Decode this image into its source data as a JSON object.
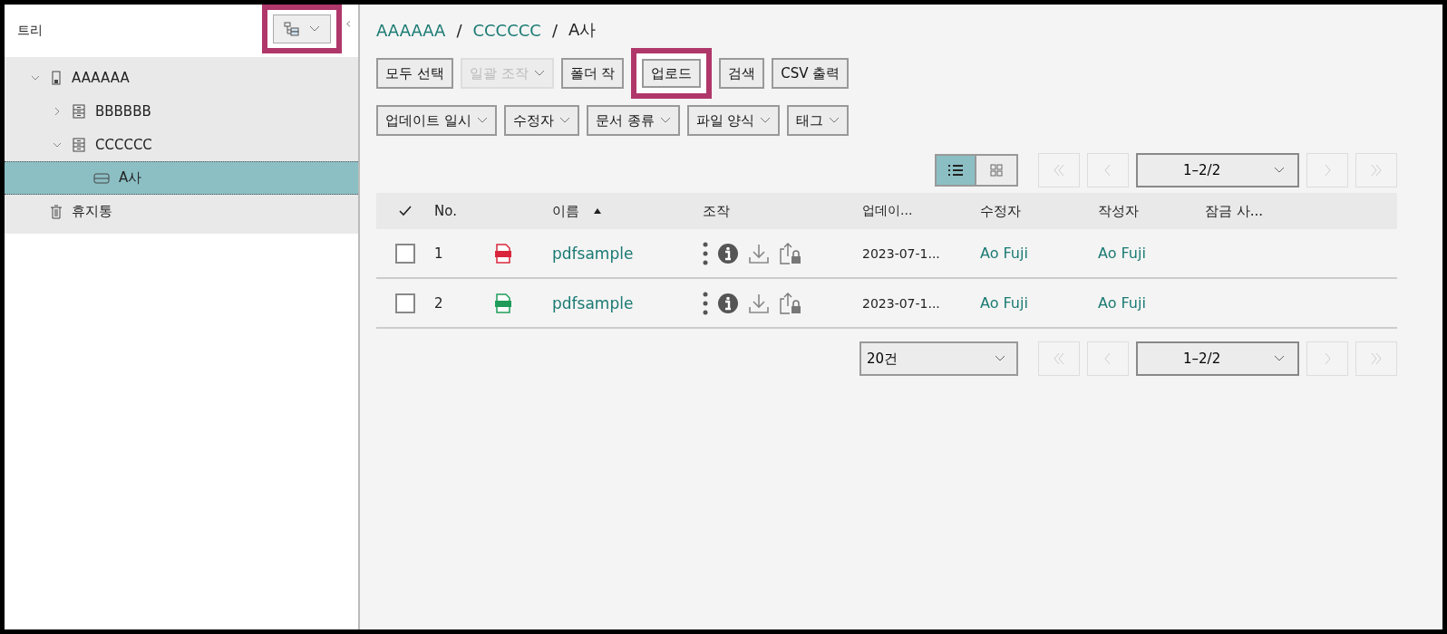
{
  "tree_panel": {
    "title": "트리",
    "collapse_glyph": "‹"
  },
  "tree": [
    {
      "label": "AAAAAA",
      "kind": "cabinet",
      "expanded": true,
      "selected": false,
      "children": [
        {
          "label": "BBBBBB",
          "kind": "drawer",
          "expanded": false,
          "selected": false
        },
        {
          "label": "CCCCCC",
          "kind": "drawer",
          "expanded": true,
          "selected": false,
          "children": [
            {
              "label": "A사",
              "kind": "folder",
              "selected": true
            }
          ]
        }
      ]
    },
    {
      "label": "휴지통",
      "kind": "trash",
      "selected": false
    }
  ],
  "breadcrumb": [
    {
      "label": "AAAAAA",
      "kind": "link"
    },
    {
      "label": "/",
      "kind": "separator"
    },
    {
      "label": "CCCCCC",
      "kind": "link"
    },
    {
      "label": "/",
      "kind": "separator"
    },
    {
      "label": "A사",
      "kind": "current"
    }
  ],
  "toolbar": [
    {
      "label": "모두 선택",
      "disabled": false,
      "dropdown": false,
      "highlighted": false
    },
    {
      "label": "일괄 조작",
      "disabled": true,
      "dropdown": true,
      "highlighted": false
    },
    {
      "label": "폴더 작",
      "disabled": false,
      "dropdown": false,
      "highlighted": false
    },
    {
      "label": "업로드",
      "disabled": false,
      "dropdown": false,
      "highlighted": true
    },
    {
      "label": "검색",
      "disabled": false,
      "dropdown": false,
      "highlighted": false
    },
    {
      "label": "CSV 출력",
      "disabled": false,
      "dropdown": false,
      "highlighted": false
    }
  ],
  "filters": [
    {
      "label": "업데이트 일시"
    },
    {
      "label": "수정자"
    },
    {
      "label": "문서 종류"
    },
    {
      "label": "파일 양식"
    },
    {
      "label": "태그"
    }
  ],
  "view_toggle": [
    {
      "kind": "list",
      "selected": true
    },
    {
      "kind": "grid",
      "selected": false
    }
  ],
  "top_pager": {
    "page": "1–2/2"
  },
  "table": {
    "columns": [
      {
        "label": "No.",
        "sorted": false
      },
      {
        "label": "이름",
        "sorted": true
      },
      {
        "label": "조작",
        "sorted": false
      },
      {
        "label": "업데이...",
        "sorted": false
      },
      {
        "label": "수정자",
        "sorted": false
      },
      {
        "label": "작성자",
        "sorted": false
      },
      {
        "label": "잠금 사...",
        "sorted": false
      }
    ],
    "rows": [
      {
        "checked": false,
        "no": "1",
        "color": "#d9263b",
        "name": "pdfsample",
        "updated": "2023-07-1...",
        "modifier": "Ao Fuji",
        "creator": "Ao Fuji"
      },
      {
        "checked": false,
        "no": "2",
        "color": "#1f9c5a",
        "name": "pdfsample",
        "updated": "2023-07-1...",
        "modifier": "Ao Fuji",
        "creator": "Ao Fuji"
      }
    ]
  },
  "bottom_pager": {
    "per_page": "20건",
    "page": "1–2/2"
  }
}
